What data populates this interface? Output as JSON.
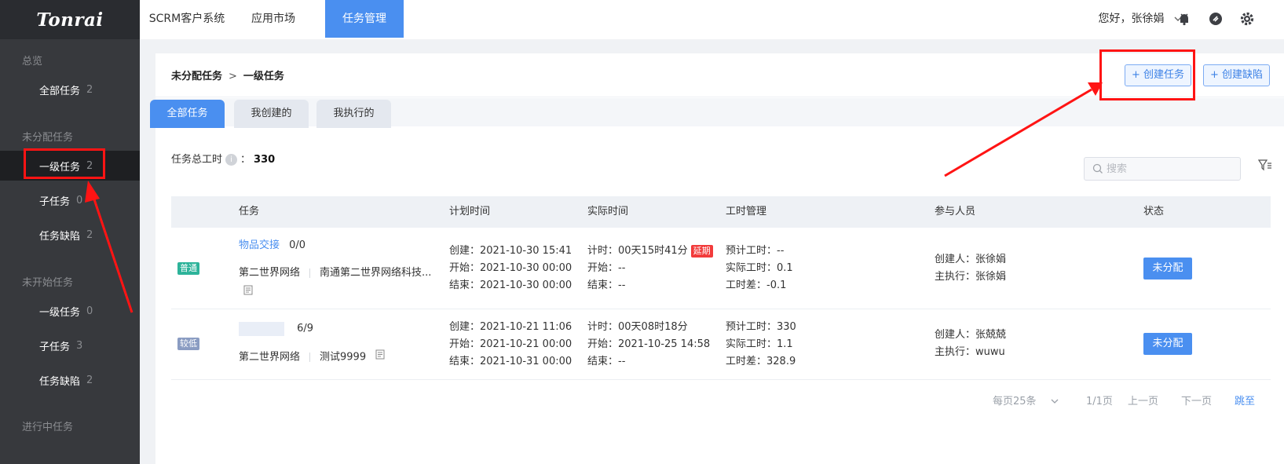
{
  "sidebar": {
    "logo": "Tonrai",
    "groups": [
      {
        "label": "总览"
      },
      {
        "label": "未分配任务"
      },
      {
        "label": "未开始任务"
      },
      {
        "label": "进行中任务"
      }
    ],
    "items": [
      {
        "label": "全部任务",
        "count": "2"
      },
      {
        "label": "一级任务",
        "count": "2"
      },
      {
        "label": "子任务",
        "count": "0"
      },
      {
        "label": "任务缺陷",
        "count": "2"
      },
      {
        "label": "一级任务",
        "count": "0"
      },
      {
        "label": "子任务",
        "count": "3"
      },
      {
        "label": "任务缺陷",
        "count": "2"
      }
    ]
  },
  "topnav": {
    "tabs": [
      "SCRM客户系统",
      "应用市场",
      "任务管理"
    ],
    "active_tab": "任务管理",
    "user_greeting": "您好，张徐娟",
    "icons": [
      "bell-icon",
      "chat-icon",
      "gear-icon"
    ]
  },
  "page": {
    "breadcrumb": {
      "parent": "未分配任务",
      "current": "一级任务",
      "separator": ">"
    },
    "create_task_label": "+ 创建任务",
    "create_defect_label": "+ 创建缺陷",
    "subtabs": [
      "全部任务",
      "我创建的",
      "我执行的"
    ],
    "summary_label": "任务总工时",
    "summary_sep": "：",
    "summary_value": "330",
    "search_placeholder": "搜索"
  },
  "table": {
    "headers": [
      "任务",
      "计划时间",
      "实际时间",
      "工时管理",
      "参与人员",
      "状态"
    ],
    "rows": [
      {
        "priority": "普通",
        "priority_color": "#2db39a",
        "task_name": "物品交接",
        "progress": "0/0",
        "company": "第二世界网络",
        "project": "南通第二世界网络科技...",
        "plan_create": "创建：2021-10-30 15:41",
        "plan_start": "开始：2021-10-30 00:00",
        "plan_end": "结束：2021-10-30 00:00",
        "actual_timer": "计时：00天15时41分",
        "delay_tag": "延期",
        "actual_start": "开始：--",
        "actual_end": "结束：--",
        "est_hours": "预计工时：--",
        "real_hours": "实际工时：0.1",
        "diff_hours": "工时差：-0.1",
        "creator": "创建人：张徐娟",
        "executor": "主执行：张徐娟",
        "status": "未分配"
      },
      {
        "priority": "较低",
        "priority_color": "#8a9cc2",
        "task_name": "",
        "progress": "6/9",
        "company": "第二世界网络",
        "project": "测试9999",
        "plan_create": "创建：2021-10-21 11:06",
        "plan_start": "开始：2021-10-21 00:00",
        "plan_end": "结束：2021-10-31 00:00",
        "actual_timer": "计时：00天08时18分",
        "actual_start": "开始：2021-10-25 14:58",
        "actual_end": "结束：--",
        "est_hours": "预计工时：330",
        "real_hours": "实际工时：1.1",
        "diff_hours": "工时差：328.9",
        "creator": "创建人：张兢兢",
        "executor": "主执行：wuwu",
        "status": "未分配"
      }
    ]
  },
  "pagination": {
    "page_size": "每页25条",
    "page_info": "1/1页",
    "prev": "上一页",
    "next": "下一页",
    "jump": "跳至"
  },
  "colors": {
    "accent": "#4a8ff0",
    "sidebar_bg": "#37393d",
    "annotation_red": "#ff1414"
  }
}
